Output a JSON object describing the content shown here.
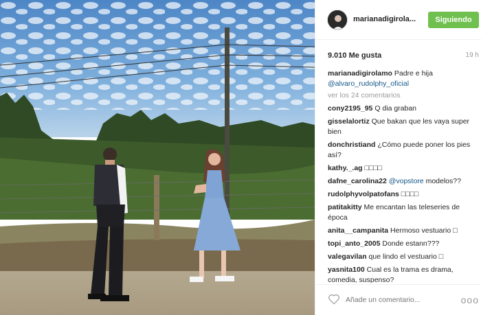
{
  "header": {
    "username": "marianadigirola...",
    "follow_label": "Siguiendo"
  },
  "meta": {
    "likes": "9.010 Me gusta",
    "time": "19 h"
  },
  "caption": {
    "username": "marianadigirolamo",
    "text": "Padre e hija",
    "mention": "@alvaro_rudolphy_oficial"
  },
  "view_more": "ver los 24 comentarios",
  "comments": [
    {
      "user": "cony2195_95",
      "text": "Q dia graban",
      "mention": ""
    },
    {
      "user": "gisselalortiz",
      "text": "Que bakan que les vaya super bien",
      "mention": ""
    },
    {
      "user": "donchristiand",
      "text": "¿Cómo puede poner los pies así?",
      "mention": ""
    },
    {
      "user": "kathy._.ag",
      "text": "□□□□",
      "mention": ""
    },
    {
      "user": "dafne_carolina22",
      "text": "modelos??",
      "mention": "@vopstore"
    },
    {
      "user": "rudolphyvolpatofans",
      "text": "□□□□",
      "mention": ""
    },
    {
      "user": "patitakitty",
      "text": "Me encantan las teleseries de época",
      "mention": ""
    },
    {
      "user": "anita__campanita",
      "text": "Hermoso vestuario □",
      "mention": ""
    },
    {
      "user": "topi_anto_2005",
      "text": "Donde estann???",
      "mention": ""
    },
    {
      "user": "valegavilan",
      "text": "que lindo el vestuario □",
      "mention": ""
    },
    {
      "user": "yasnita100",
      "text": "Cual es la trama es drama, comedia, suspenso?",
      "mention": ""
    }
  ],
  "footer": {
    "add_comment_placeholder": "Añade un comentario...",
    "more_label": "ooo"
  },
  "colors": {
    "follow_green": "#70c050",
    "link_blue": "#125688",
    "muted_gray": "#999999"
  }
}
